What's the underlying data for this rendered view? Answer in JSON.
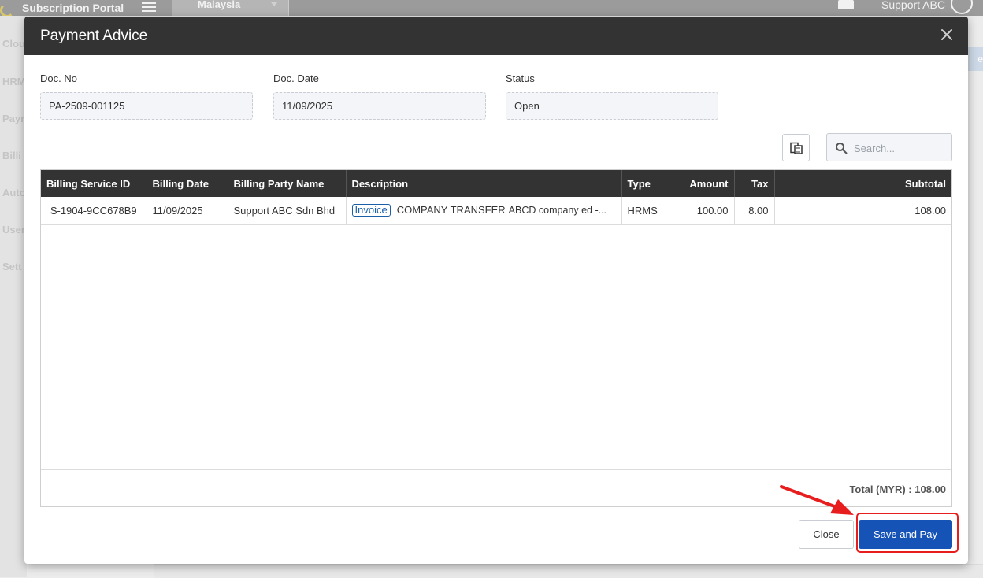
{
  "app": {
    "brand": "Subscription Portal",
    "country": "Malaysia",
    "user": "Support ABC",
    "sidebar_items": [
      "Clou",
      "HRM",
      "Payr",
      "Billi",
      "Auto",
      "User",
      "Sett"
    ],
    "right_stub": "e"
  },
  "modal": {
    "title": "Payment Advice",
    "fields": [
      {
        "label": "Doc. No",
        "value": "PA-2509-001125"
      },
      {
        "label": "Doc. Date",
        "value": "11/09/2025"
      },
      {
        "label": "Status",
        "value": "Open"
      }
    ],
    "search_placeholder": "Search...",
    "table": {
      "columns": [
        "Billing Service ID",
        "Billing Date",
        "Billing Party Name",
        "Description",
        "Type",
        "Amount",
        "Tax",
        "Subtotal"
      ],
      "rows": [
        {
          "service_id": "S-1904-9CC678B9",
          "date": "11/09/2025",
          "party": "Support ABC Sdn Bhd",
          "badge": "Invoice",
          "description": "COMPANY TRANSFER",
          "description_detail": "ABCD company ed -...",
          "type": "HRMS",
          "amount": "100.00",
          "tax": "8.00",
          "subtotal": "108.00"
        }
      ],
      "total": "Total (MYR) : 108.00"
    },
    "buttons": {
      "close": "Close",
      "save_and_pay": "Save and Pay"
    }
  },
  "colors": {
    "header": "#333333",
    "primary": "#1553b7",
    "annotation": "#e81d1d",
    "badge": "#1a5fa8"
  }
}
